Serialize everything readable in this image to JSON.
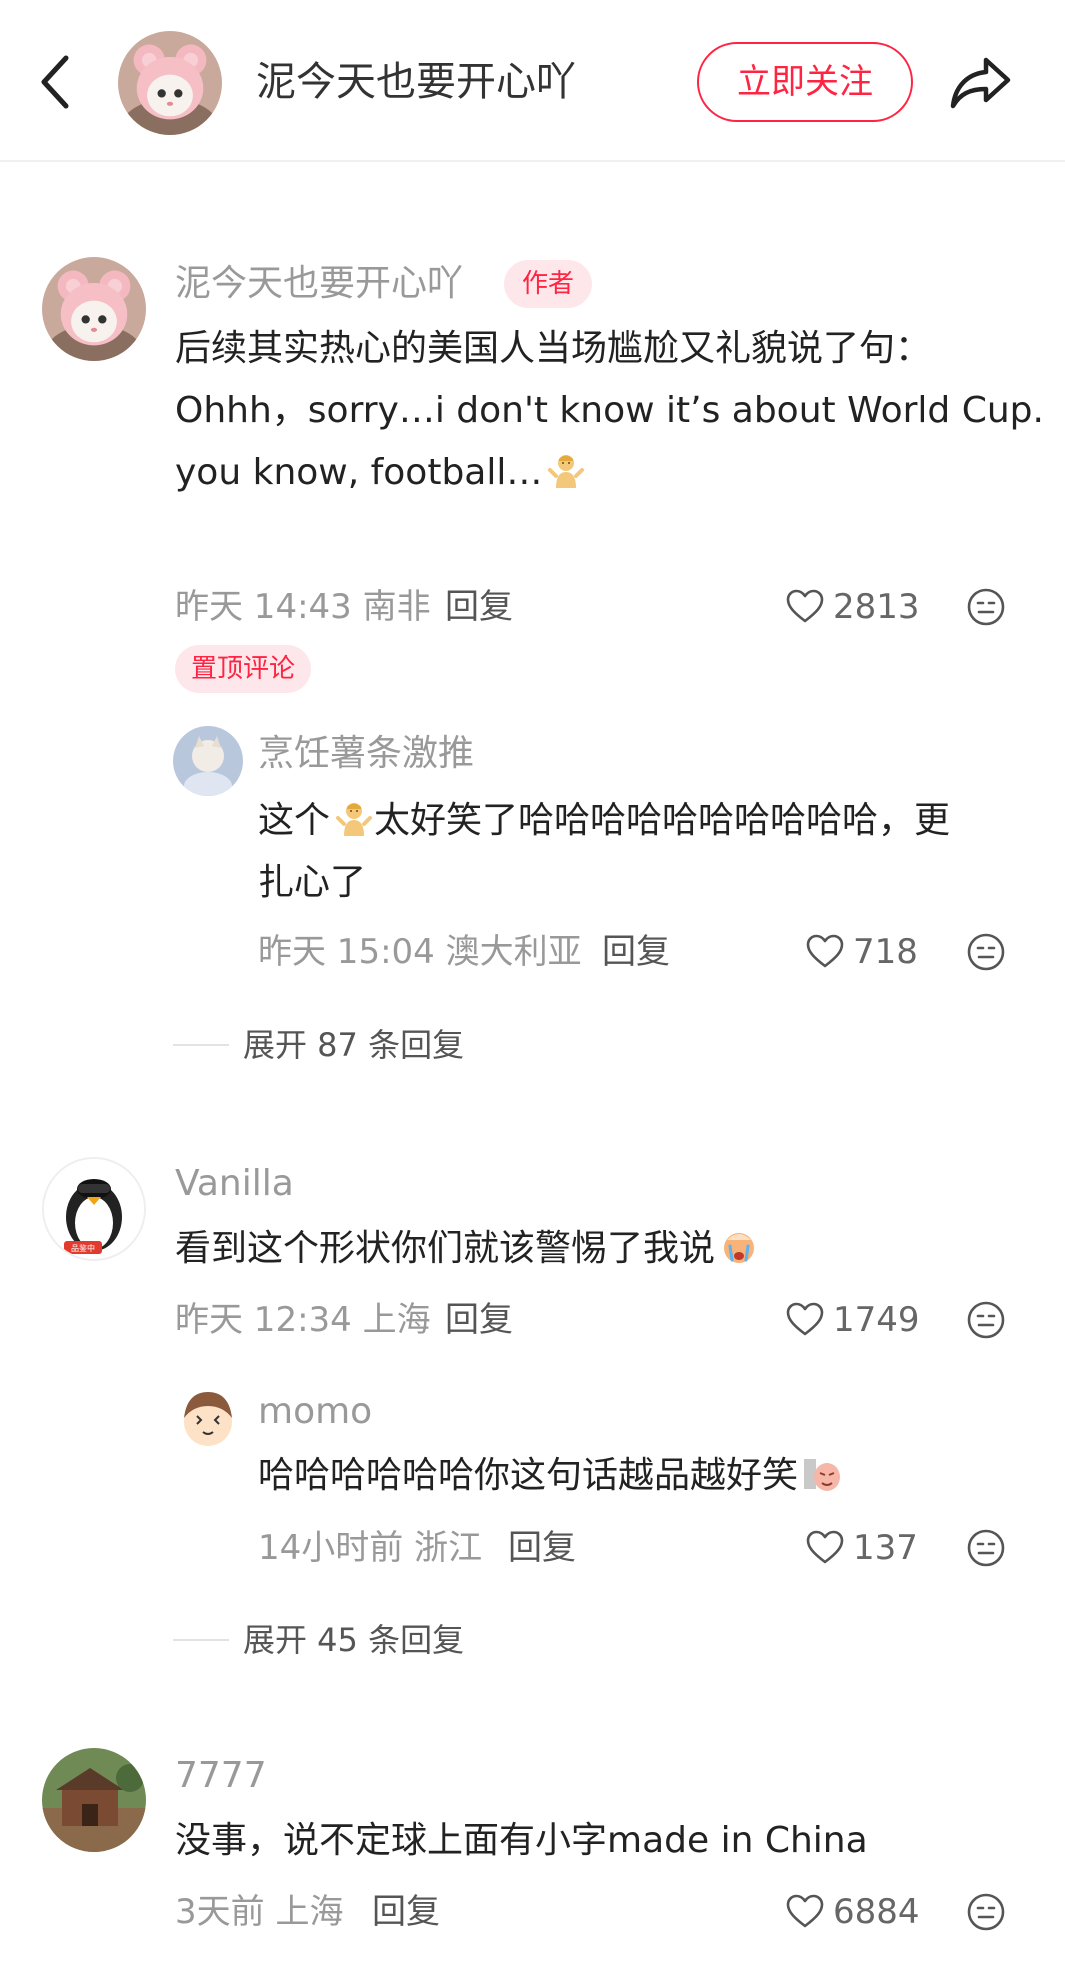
{
  "header": {
    "author_name": "泥今天也要开心吖",
    "follow_label": "立即关注"
  },
  "comments": [
    {
      "nickname": "泥今天也要开心吖",
      "author_tag": "作者",
      "text_lines": [
        "后续其实热心的美国人当场尴尬又礼貌说了句：",
        "Ohhh，sorry…i don't know it’s about World Cup.",
        "you know, football…"
      ],
      "time_location": "昨天 14:43 南非",
      "reply_label": "回复",
      "likes": "2813",
      "pin_tag": "置顶评论",
      "replies": [
        {
          "nickname": "烹饪薯条激推",
          "text_lines": [
            "这个",
            "太好笑了哈哈哈哈哈哈哈哈哈哈，更",
            "扎心了"
          ],
          "time_location": "昨天 15:04 澳大利亚",
          "reply_label": "回复",
          "likes": "718"
        }
      ],
      "expand_label": "展开 87 条回复"
    },
    {
      "nickname": "Vanilla",
      "text": "看到这个形状你们就该警惕了我说",
      "time_location": "昨天 12:34 上海",
      "reply_label": "回复",
      "likes": "1749",
      "avatar_badge": "品鉴中",
      "replies": [
        {
          "nickname": "momo",
          "text": "哈哈哈哈哈哈你这句话越品越好笑",
          "time_location": "14小时前 浙江",
          "reply_label": "回复",
          "likes": "137"
        }
      ],
      "expand_label": "展开 45 条回复"
    },
    {
      "nickname": "7777",
      "text": "没事，说不定球上面有小字made in China",
      "time_location": "3天前 上海",
      "reply_label": "回复",
      "likes": "6884"
    }
  ],
  "colors": {
    "accent": "#ff2442",
    "muted_text": "#999999",
    "body_text": "#222222"
  },
  "icons": [
    "back-arrow-icon",
    "share-icon",
    "heart-icon",
    "reaction-face-icon",
    "shrug-emoji",
    "crying-emoji",
    "laughing-meme-emoji"
  ]
}
